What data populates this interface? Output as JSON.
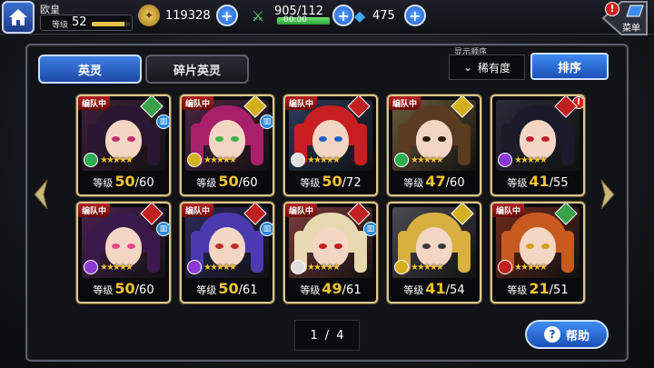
{
  "player": {
    "name": "欧皇",
    "level_label": "等级",
    "level": "52",
    "exp_fraction": 0.85
  },
  "resources": {
    "gold": "119328",
    "stamina": "905/112",
    "stamina_timer": "00:00",
    "gems": "475"
  },
  "menu": {
    "label": "菜单",
    "badge": "!"
  },
  "tabs": {
    "heroes": "英灵",
    "fragments": "碎片英灵"
  },
  "sort": {
    "caption": "显示顺序",
    "current": "稀有度",
    "button": "排序"
  },
  "pager": {
    "current": "1",
    "separator": "/",
    "total": "4"
  },
  "help": {
    "q": "?",
    "label": "帮助"
  },
  "cards": [
    {
      "badge": "编队中",
      "lv_prefix": "等级",
      "lv": "50",
      "lv_max": "/60",
      "stars": "★★★★★",
      "hair": "#2a1630",
      "bg": "#3d1f3a",
      "eye": "#c0306a",
      "class_color": "#3aa04a",
      "element": "#2fae54",
      "book": true,
      "alert": false
    },
    {
      "badge": "编队中",
      "lv_prefix": "等级",
      "lv": "50",
      "lv_max": "/60",
      "stars": "★★★★★",
      "hair": "#a8206a",
      "bg": "#4a2440",
      "eye": "#3fb04a",
      "class_color": "#d4b020",
      "element": "#d4b020",
      "book": true,
      "alert": false
    },
    {
      "badge": "编队中",
      "lv_prefix": "等级",
      "lv": "50",
      "lv_max": "/72",
      "stars": "★★★★★",
      "hair": "#c81e22",
      "bg": "#2a3a5a",
      "eye": "#2060c8",
      "class_color": "#c02020",
      "element": "#e0e0e0",
      "book": false,
      "alert": false
    },
    {
      "badge": "编队中",
      "lv_prefix": "等级",
      "lv": "47",
      "lv_max": "/60",
      "stars": "★★★★★",
      "hair": "#5a3a20",
      "bg": "#6a5a38",
      "eye": "#2a1a10",
      "class_color": "#d4b020",
      "element": "#2fae54",
      "book": false,
      "alert": false
    },
    {
      "badge": "",
      "lv_prefix": "等级",
      "lv": "41",
      "lv_max": "/55",
      "stars": "★★★★★",
      "hair": "#1a1a2a",
      "bg": "#2a2a38",
      "eye": "#c02030",
      "class_color": "#c02020",
      "element": "#8a3ad0",
      "book": false,
      "alert": true
    },
    {
      "badge": "编队中",
      "lv_prefix": "等级",
      "lv": "50",
      "lv_max": "/60",
      "stars": "★★★★★",
      "hair": "#3a1a4a",
      "bg": "#4a2050",
      "eye": "#e04a8a",
      "class_color": "#c02020",
      "element": "#8a3ad0",
      "book": true,
      "alert": false
    },
    {
      "badge": "编队中",
      "lv_prefix": "等级",
      "lv": "50",
      "lv_max": "/61",
      "stars": "★★★★★",
      "hair": "#4a3ab0",
      "bg": "#2a2a5a",
      "eye": "#c0302a",
      "class_color": "#c02020",
      "element": "#8a3ad0",
      "book": true,
      "alert": false
    },
    {
      "badge": "编队中",
      "lv_prefix": "等级",
      "lv": "49",
      "lv_max": "/61",
      "stars": "★★★★★",
      "hair": "#e8d8b0",
      "bg": "#7a3a3a",
      "eye": "#c02020",
      "class_color": "#c02020",
      "element": "#e0e0e0",
      "book": true,
      "alert": false
    },
    {
      "badge": "",
      "lv_prefix": "等级",
      "lv": "41",
      "lv_max": "/54",
      "stars": "★★★★★",
      "hair": "#d8b040",
      "bg": "#4a4a50",
      "eye": "#3a3a3a",
      "class_color": "#d4b020",
      "element": "#d4b020",
      "book": false,
      "alert": false
    },
    {
      "badge": "编队中",
      "lv_prefix": "等级",
      "lv": "21",
      "lv_max": "/51",
      "stars": "★★★★★",
      "hair": "#c85a20",
      "bg": "#6a2a1a",
      "eye": "#d4a020",
      "class_color": "#3aa04a",
      "element": "#c02020",
      "book": false,
      "alert": false
    }
  ],
  "colors": {
    "accent_blue": "#1d5fcf",
    "gold_text": "#f2c431",
    "party_red": "#b02020"
  }
}
